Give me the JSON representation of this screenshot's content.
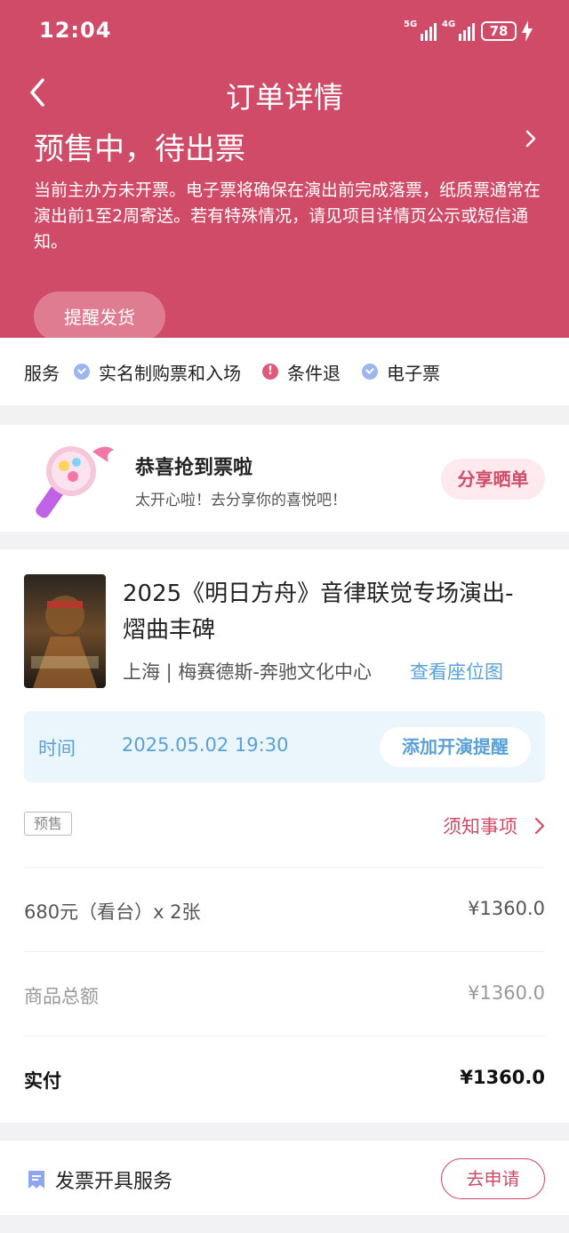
{
  "status_bar": {
    "time": "12:04",
    "net1": "5G",
    "net2": "4G",
    "battery": "78"
  },
  "header": {
    "title": "订单详情",
    "order_status": "预售中，待出票",
    "status_desc": "当前主办方未开票。电子票将确保在演出前完成落票，纸质票通常在演出前1至2周寄送。若有特殊情况，请见项目详情页公示或短信通知。",
    "remind_button": "提醒发货"
  },
  "services": {
    "label": "服务",
    "items": [
      {
        "label": "实名制购票和入场",
        "icon": "check-circle-icon"
      },
      {
        "label": "条件退",
        "icon": "exclamation-circle-icon"
      },
      {
        "label": "电子票",
        "icon": "check-circle-icon"
      }
    ]
  },
  "congrats": {
    "title": "恭喜抢到票啦",
    "subtitle": "太开心啦！去分享你的喜悦吧！",
    "share_button": "分享晒单"
  },
  "ticket": {
    "show_title": "2025《明日方舟》音律联觉专场演出-熠曲丰碑",
    "venue": "上海 | 梅赛德斯-奔驰文化中心",
    "seatmap_link": "查看座位图",
    "time_label": "时间",
    "time_value": "2025.05.02 19:30",
    "reminder_button": "添加开演提醒",
    "tag": "预售",
    "notice_link": "须知事项",
    "line_item_label": "680元（看台）x 2张",
    "line_item_price": "¥1360.0",
    "subtotal_label": "商品总额",
    "subtotal_value": "¥1360.0",
    "paid_label": "实付",
    "paid_value": "¥1360.0"
  },
  "invoice": {
    "label": "发票开具服务",
    "button": "去申请"
  },
  "colors": {
    "brand": "#d04b68",
    "link": "#5aa1d8",
    "header_bg": "#d04b68"
  }
}
